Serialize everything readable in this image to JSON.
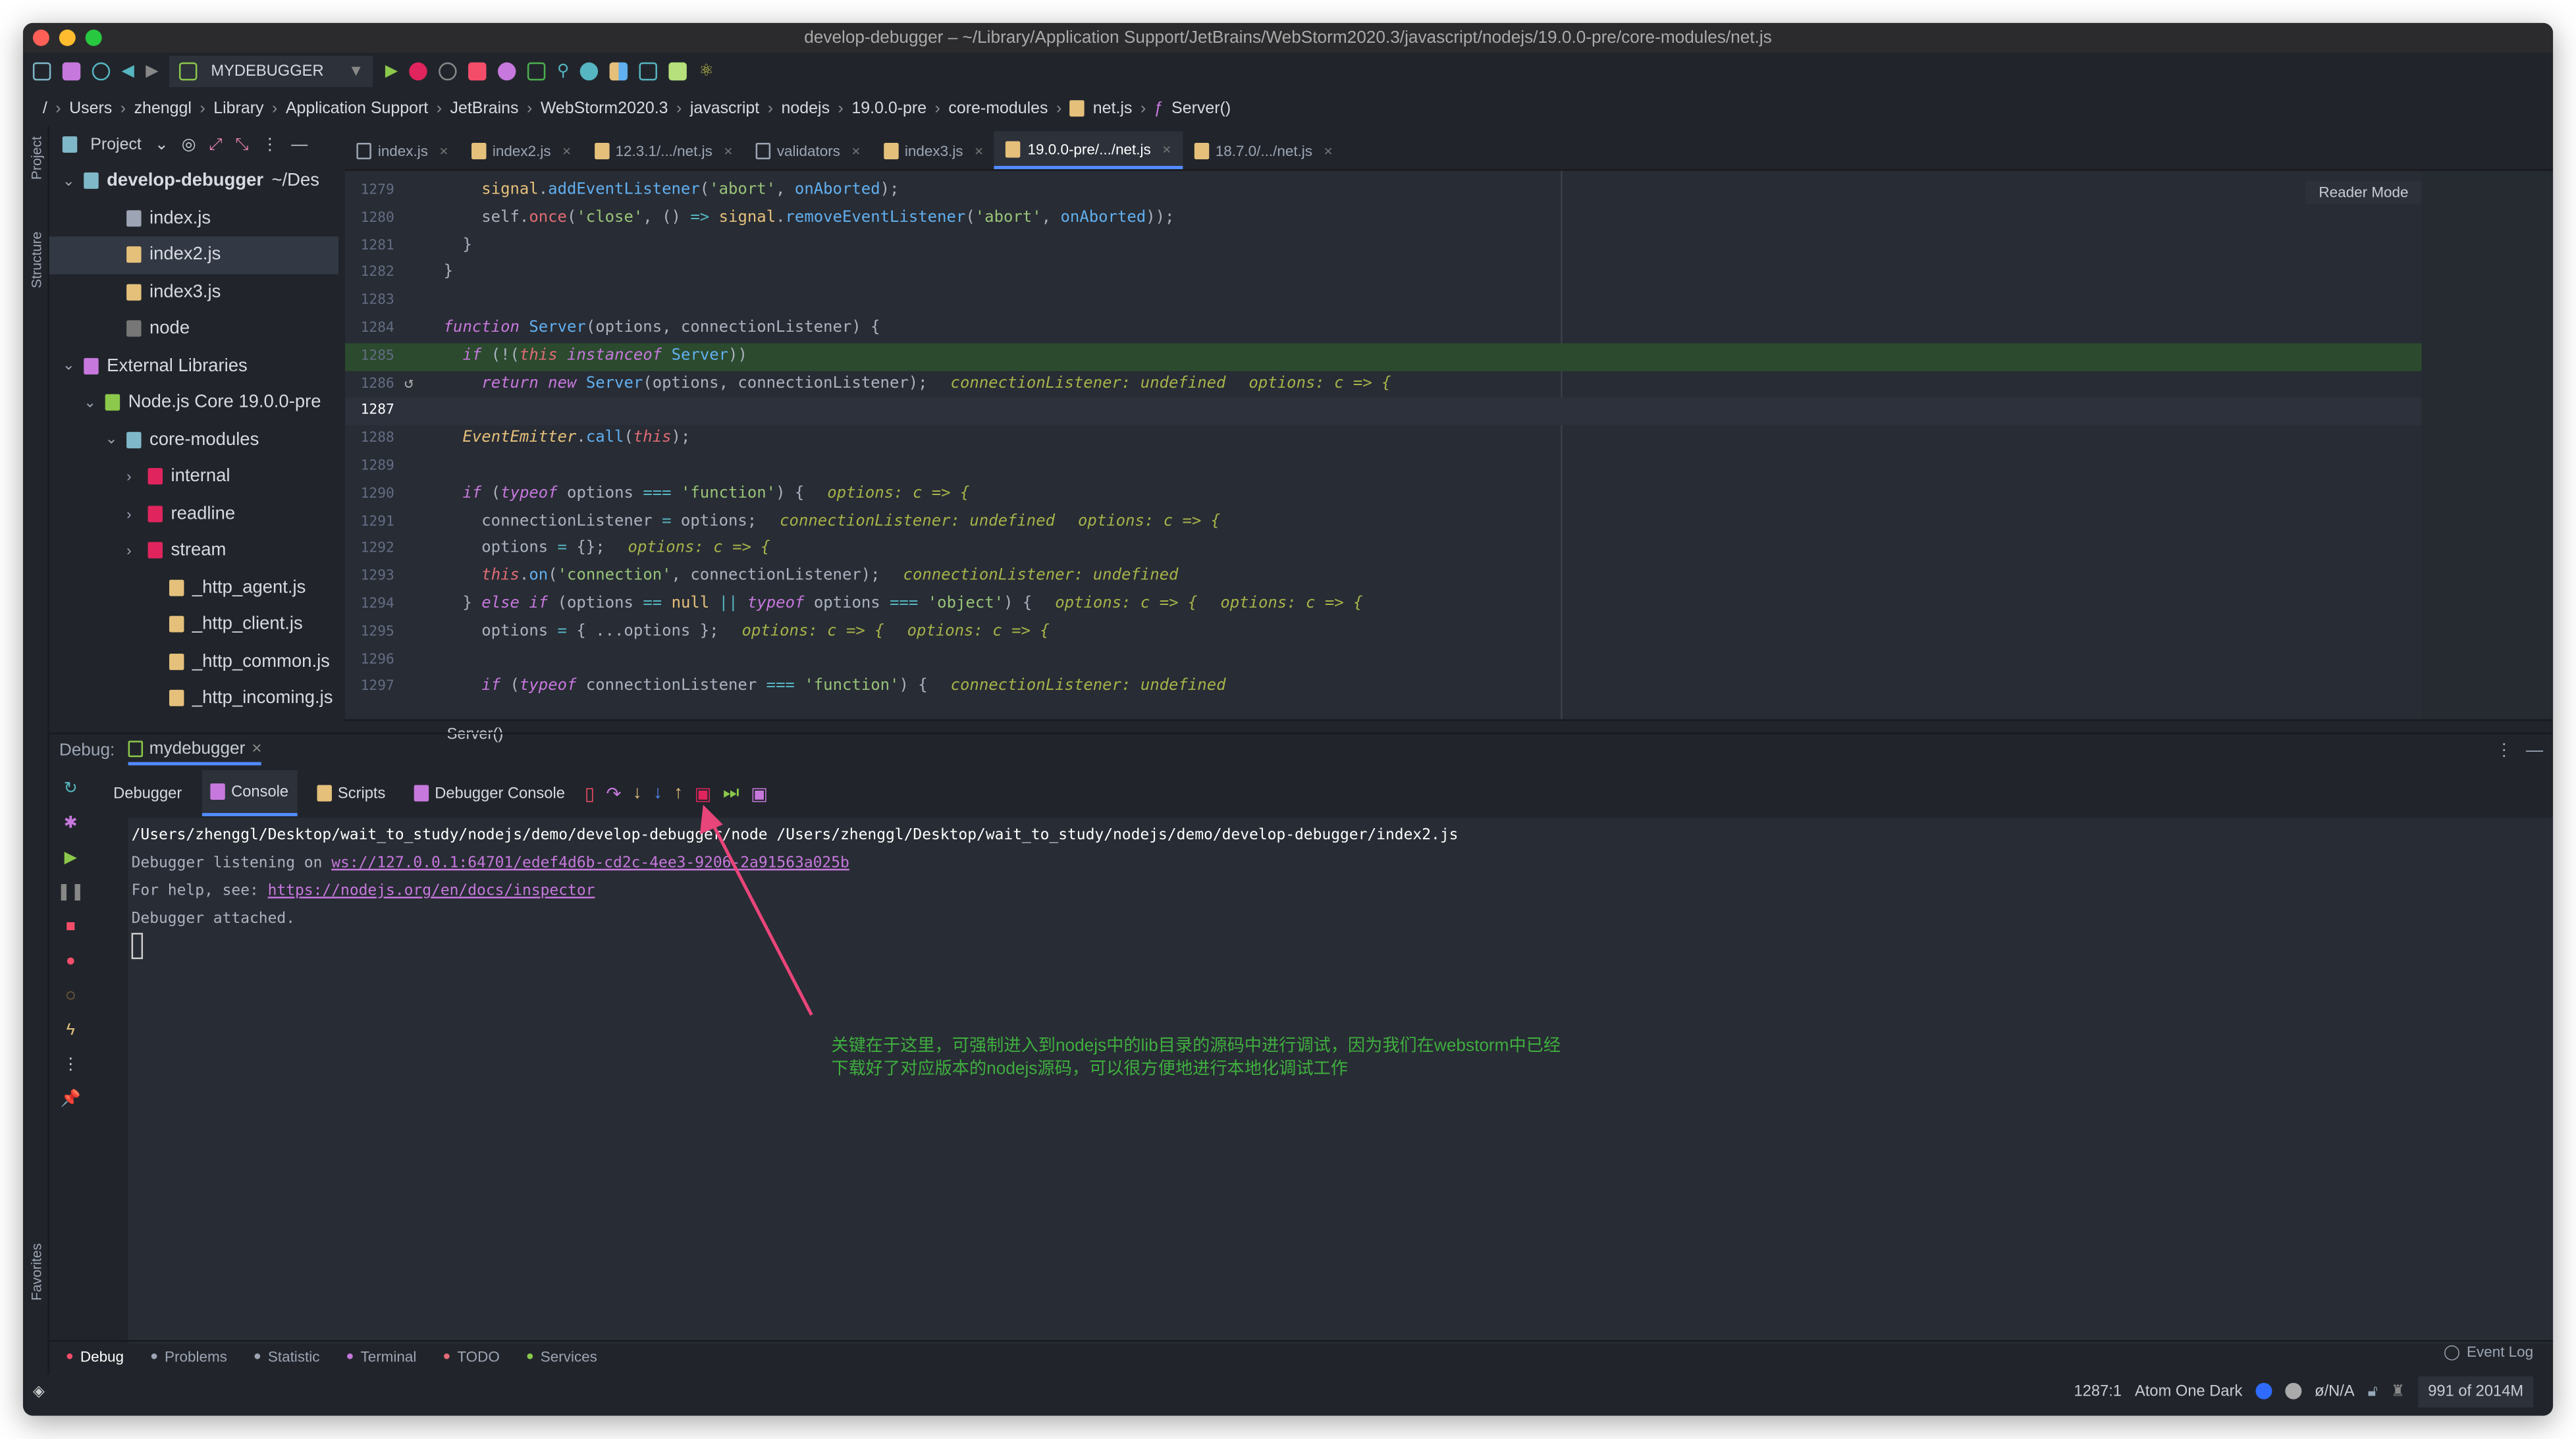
{
  "window": {
    "title": "develop-debugger – ~/Library/Application Support/JetBrains/WebStorm2020.3/javascript/nodejs/19.0.0-pre/core-modules/net.js"
  },
  "toolbar": {
    "run_config": "MYDEBUGGER"
  },
  "breadcrumb": [
    "/",
    "Users",
    "zhenggl",
    "Library",
    "Application Support",
    "JetBrains",
    "WebStorm2020.3",
    "javascript",
    "nodejs",
    "19.0.0-pre",
    "core-modules",
    "net.js",
    "Server()"
  ],
  "side_labels": {
    "project": "Project",
    "structure": "Structure",
    "favorites": "Favorites"
  },
  "project": {
    "header": "Project",
    "tree": [
      {
        "label": "develop-debugger",
        "suffix": " ~/Des",
        "indent": 0,
        "type": "folder",
        "arrow": "v",
        "bold": true
      },
      {
        "label": "index.js",
        "indent": 2,
        "type": "list"
      },
      {
        "label": "index2.js",
        "indent": 2,
        "type": "js",
        "selected": true
      },
      {
        "label": "index3.js",
        "indent": 2,
        "type": "js"
      },
      {
        "label": "node",
        "indent": 2,
        "type": "file"
      },
      {
        "label": "External Libraries",
        "indent": 0,
        "type": "lib",
        "arrow": "v"
      },
      {
        "label": "Node.js Core  19.0.0-pre",
        "indent": 1,
        "type": "node",
        "arrow": "v"
      },
      {
        "label": "core-modules",
        "indent": 2,
        "type": "folder",
        "arrow": "v"
      },
      {
        "label": "internal",
        "indent": 3,
        "type": "redfolder",
        "arrow": ">"
      },
      {
        "label": "readline",
        "indent": 3,
        "type": "redfolder",
        "arrow": ">"
      },
      {
        "label": "stream",
        "indent": 3,
        "type": "redfolder",
        "arrow": ">"
      },
      {
        "label": "_http_agent.js",
        "indent": 4,
        "type": "js"
      },
      {
        "label": "_http_client.js",
        "indent": 4,
        "type": "js"
      },
      {
        "label": "_http_common.js",
        "indent": 4,
        "type": "js"
      },
      {
        "label": "_http_incoming.js",
        "indent": 4,
        "type": "js"
      }
    ]
  },
  "tabs": [
    {
      "label": "index.js",
      "icon": "list"
    },
    {
      "label": "index2.js",
      "icon": "js"
    },
    {
      "label": "12.3.1/.../net.js",
      "icon": "js"
    },
    {
      "label": "validators",
      "icon": "binary"
    },
    {
      "label": "index3.js",
      "icon": "js"
    },
    {
      "label": "19.0.0-pre/.../net.js",
      "icon": "js",
      "active": true
    },
    {
      "label": "18.7.0/.../net.js",
      "icon": "js"
    }
  ],
  "editor": {
    "reader_mode": "Reader Mode",
    "footer_crumb": "Server()",
    "lines": [
      {
        "n": "1279",
        "tk": [
          [
            "    ",
            "p"
          ],
          [
            "signal",
            "v"
          ],
          [
            ".",
            "p"
          ],
          [
            "addEventListener",
            "fn"
          ],
          [
            "(",
            "p"
          ],
          [
            "'abort'",
            "s"
          ],
          [
            ", ",
            "p"
          ],
          [
            "onAborted",
            "fn"
          ],
          [
            ");",
            "p"
          ]
        ]
      },
      {
        "n": "1280",
        "tk": [
          [
            "    self.",
            "p"
          ],
          [
            "once",
            "m"
          ],
          [
            "(",
            "p"
          ],
          [
            "'close'",
            "s"
          ],
          [
            ", () ",
            "p"
          ],
          [
            "=>",
            "op"
          ],
          [
            " ",
            "p"
          ],
          [
            "signal",
            "v"
          ],
          [
            ".",
            "p"
          ],
          [
            "removeEventListener",
            "fn"
          ],
          [
            "(",
            "p"
          ],
          [
            "'abort'",
            "s"
          ],
          [
            ", ",
            "p"
          ],
          [
            "onAborted",
            "fn"
          ],
          [
            "));",
            "p"
          ]
        ]
      },
      {
        "n": "1281",
        "tk": [
          [
            "  }",
            "p"
          ]
        ]
      },
      {
        "n": "1282",
        "tk": [
          [
            "}",
            "p"
          ]
        ]
      },
      {
        "n": "1283",
        "tk": []
      },
      {
        "n": "1284",
        "tk": [
          [
            "function",
            "k"
          ],
          [
            " ",
            "p"
          ],
          [
            "Server",
            "fn"
          ],
          [
            "(options, connectionListener) {",
            "p"
          ]
        ]
      },
      {
        "n": "1285",
        "hl": true,
        "tk": [
          [
            "  ",
            "p"
          ],
          [
            "if",
            "k"
          ],
          [
            " (!(",
            "p"
          ],
          [
            "this",
            "t"
          ],
          [
            " ",
            "p"
          ],
          [
            "instanceof",
            "k"
          ],
          [
            " ",
            "p"
          ],
          [
            "Server",
            "fn"
          ],
          [
            "))",
            "p"
          ]
        ]
      },
      {
        "n": "1286",
        "tk": [
          [
            "    ",
            "p"
          ],
          [
            "return",
            "k"
          ],
          [
            " ",
            "p"
          ],
          [
            "new",
            "k"
          ],
          [
            " ",
            "p"
          ],
          [
            "Server",
            "fn"
          ],
          [
            "(options, connectionListener);",
            "p"
          ]
        ],
        "hints": [
          "connectionListener: undefined",
          "options: c => {"
        ]
      },
      {
        "n": "1287",
        "cur": true,
        "tk": []
      },
      {
        "n": "1288",
        "tk": [
          [
            "  ",
            "p"
          ],
          [
            "EventEmitter",
            "cls"
          ],
          [
            ".",
            "p"
          ],
          [
            "call",
            "fn"
          ],
          [
            "(",
            "p"
          ],
          [
            "this",
            "t"
          ],
          [
            ");",
            "p"
          ]
        ]
      },
      {
        "n": "1289",
        "tk": []
      },
      {
        "n": "1290",
        "tk": [
          [
            "  ",
            "p"
          ],
          [
            "if",
            "k"
          ],
          [
            " (",
            "p"
          ],
          [
            "typeof",
            "k"
          ],
          [
            " options ",
            "p"
          ],
          [
            "===",
            "op"
          ],
          [
            " ",
            "p"
          ],
          [
            "'function'",
            "s"
          ],
          [
            ") {",
            "p"
          ]
        ],
        "hints": [
          "options: c => {"
        ]
      },
      {
        "n": "1291",
        "tk": [
          [
            "    connectionListener ",
            "p"
          ],
          [
            "=",
            "op"
          ],
          [
            " options;",
            "p"
          ]
        ],
        "hints": [
          "connectionListener: undefined",
          "options: c => {"
        ]
      },
      {
        "n": "1292",
        "tk": [
          [
            "    options ",
            "p"
          ],
          [
            "=",
            "op"
          ],
          [
            " {};",
            "p"
          ]
        ],
        "hints": [
          "options: c => {"
        ]
      },
      {
        "n": "1293",
        "tk": [
          [
            "    ",
            "p"
          ],
          [
            "this",
            "t"
          ],
          [
            ".",
            "p"
          ],
          [
            "on",
            "fn"
          ],
          [
            "(",
            "p"
          ],
          [
            "'connection'",
            "s"
          ],
          [
            ", connectionListener);",
            "p"
          ]
        ],
        "hints": [
          "connectionListener: undefined"
        ]
      },
      {
        "n": "1294",
        "tk": [
          [
            "  } ",
            "p"
          ],
          [
            "else",
            "k"
          ],
          [
            " ",
            "p"
          ],
          [
            "if",
            "k"
          ],
          [
            " (options ",
            "p"
          ],
          [
            "==",
            "op"
          ],
          [
            " ",
            "p"
          ],
          [
            "null",
            "v"
          ],
          [
            " ",
            "p"
          ],
          [
            "||",
            "op"
          ],
          [
            " ",
            "p"
          ],
          [
            "typeof",
            "k"
          ],
          [
            " options ",
            "p"
          ],
          [
            "===",
            "op"
          ],
          [
            " ",
            "p"
          ],
          [
            "'object'",
            "s"
          ],
          [
            ") {",
            "p"
          ]
        ],
        "hints": [
          "options: c => {",
          "options: c => {"
        ]
      },
      {
        "n": "1295",
        "tk": [
          [
            "    options ",
            "p"
          ],
          [
            "=",
            "op"
          ],
          [
            " { ...options };",
            "p"
          ]
        ],
        "hints": [
          "options: c => {",
          "options: c => {"
        ]
      },
      {
        "n": "1296",
        "tk": []
      },
      {
        "n": "1297",
        "tk": [
          [
            "    ",
            "p"
          ],
          [
            "if",
            "k"
          ],
          [
            " (",
            "p"
          ],
          [
            "typeof",
            "k"
          ],
          [
            " connectionListener ",
            "p"
          ],
          [
            "===",
            "op"
          ],
          [
            " ",
            "p"
          ],
          [
            "'function'",
            "s"
          ],
          [
            ") {",
            "p"
          ]
        ],
        "hints": [
          "connectionListener: undefined"
        ]
      }
    ]
  },
  "debug": {
    "label": "Debug:",
    "session": "mydebugger",
    "tabs": [
      {
        "label": "Debugger"
      },
      {
        "label": "Console",
        "active": true
      },
      {
        "label": "Scripts"
      },
      {
        "label": "Debugger Console"
      }
    ],
    "console": {
      "cmd": "/Users/zhenggl/Desktop/wait_to_study/nodejs/demo/develop-debugger/node /Users/zhenggl/Desktop/wait_to_study/nodejs/demo/develop-debugger/index2.js",
      "listen_prefix": "Debugger listening on ",
      "listen_url": "ws://127.0.0.1:64701/edef4d6b-cd2c-4ee3-9206-2a91563a025b",
      "help_prefix": "For help, see: ",
      "help_url": "https://nodejs.org/en/docs/inspector",
      "attached": "Debugger attached."
    }
  },
  "annotation": {
    "line1": "关键在于这里，可强制进入到nodejs中的lib目录的源码中进行调试，因为我们在webstorm中已经",
    "line2": "下载好了对应版本的nodejs源码，可以很方便地进行本地化调试工作",
    "color": "#3fae3f",
    "arrow_color": "#e8457a"
  },
  "bottom_tools": [
    {
      "label": "Debug",
      "icon": "bug-icon"
    },
    {
      "label": "Problems",
      "icon": "info-icon"
    },
    {
      "label": "Statistic",
      "icon": "pie-icon"
    },
    {
      "label": "Terminal",
      "icon": "terminal-icon"
    },
    {
      "label": "TODO",
      "icon": "todo-icon"
    },
    {
      "label": "Services",
      "icon": "services-icon"
    }
  ],
  "status": {
    "event_log": "Event Log",
    "position": "1287:1",
    "theme": "Atom One Dark",
    "vcs": "ø/N/A",
    "memory": "991 of 2014M"
  },
  "colors": {
    "accent": "#528bff",
    "background": "#21252b",
    "editor": "#282c34"
  }
}
